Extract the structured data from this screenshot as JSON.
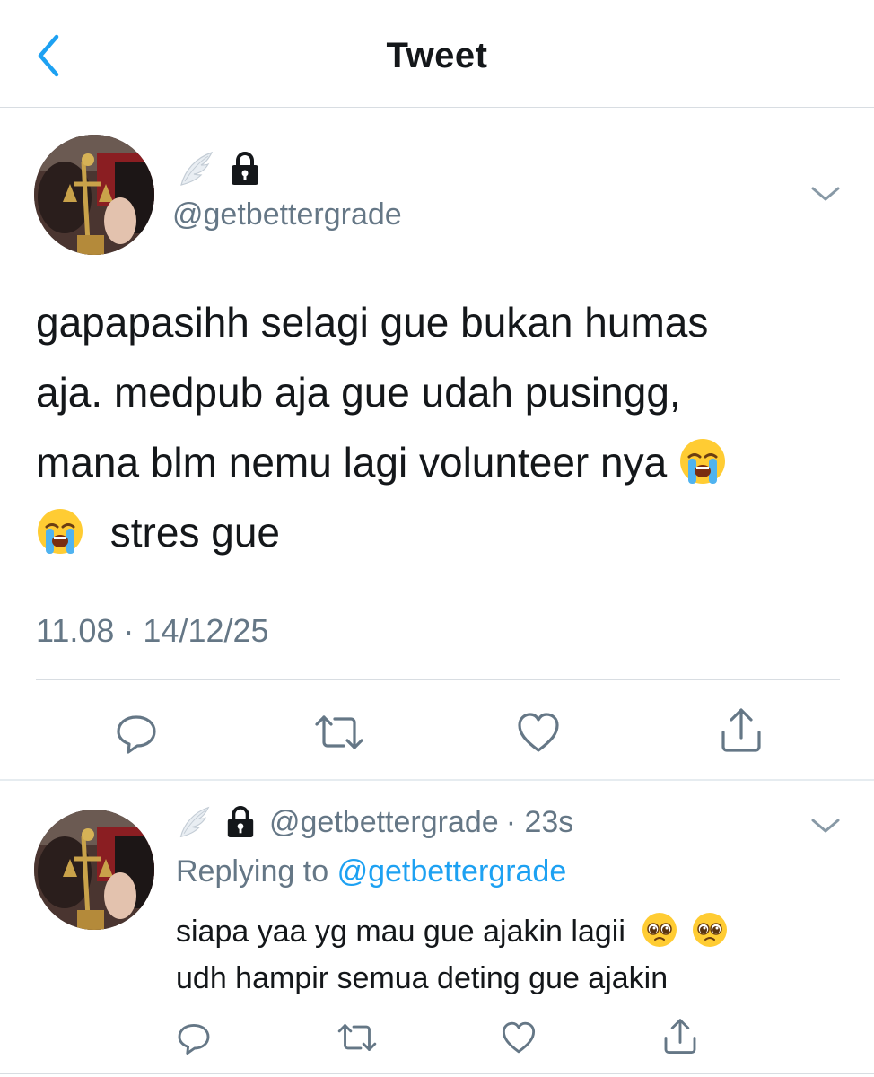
{
  "header": {
    "title": "Tweet"
  },
  "tweet": {
    "handle": "@getbettergrade",
    "text_line1": "gapapasihh selagi gue bukan humas",
    "text_line2": "aja. medpub aja gue udah pusingg,",
    "text_line3": "mana blm nemu lagi volunteer nya",
    "text_line4": "stres gue",
    "timestamp": "11.08 · 14/12/25"
  },
  "reply": {
    "handle": "@getbettergrade",
    "time": "· 23s",
    "replying_prefix": "Replying to",
    "replying_to": "@getbettergrade",
    "text_line1": "siapa yaa yg mau gue ajakin lagii",
    "text_line2": "udh hampir semua deting gue ajakin"
  },
  "icons": {
    "back": "chevron-left-icon",
    "wing": "wing-icon",
    "lock": "lock-icon",
    "caret": "chevron-down-icon",
    "reply": "reply-icon",
    "retweet": "retweet-icon",
    "like": "heart-icon",
    "share": "share-icon",
    "emoji_main": "loudly-crying-face-emoji",
    "emoji_reply": "pleading-face-emoji"
  },
  "colors": {
    "accent": "#1da1f2",
    "secondary_text": "#657786",
    "divider": "#d8dde2"
  }
}
